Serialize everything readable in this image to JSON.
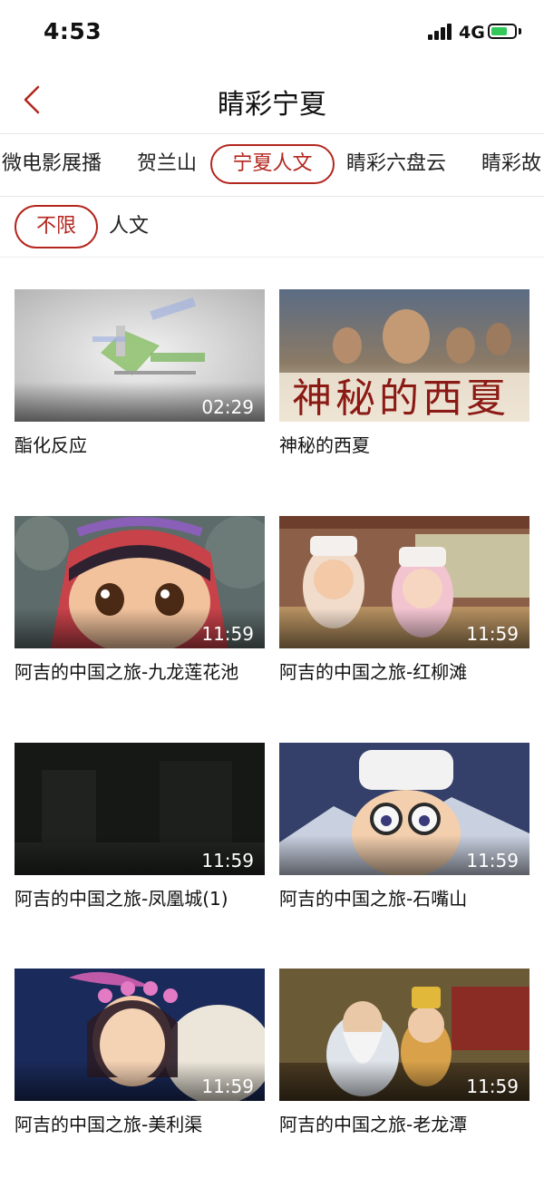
{
  "status": {
    "time": "4:53",
    "network": "4G"
  },
  "header": {
    "title": "睛彩宁夏"
  },
  "tabs": [
    {
      "label": "微电影展播",
      "active": false
    },
    {
      "label": "贺兰山",
      "active": false
    },
    {
      "label": "宁夏人文",
      "active": true
    },
    {
      "label": "睛彩六盘云",
      "active": false
    },
    {
      "label": "睛彩故",
      "active": false
    }
  ],
  "filters": [
    {
      "label": "不限",
      "active": true
    },
    {
      "label": "人文",
      "active": false
    }
  ],
  "videos": [
    {
      "title": "酯化反应",
      "duration": "02:29"
    },
    {
      "title": "神秘的西夏",
      "duration": "",
      "overlay": "神秘的西夏"
    },
    {
      "title": "阿吉的中国之旅-九龙莲花池",
      "duration": "11:59"
    },
    {
      "title": "阿吉的中国之旅-红柳滩",
      "duration": "11:59"
    },
    {
      "title": "阿吉的中国之旅-凤凰城(1)",
      "duration": "11:59"
    },
    {
      "title": "阿吉的中国之旅-石嘴山",
      "duration": "11:59"
    },
    {
      "title": "阿吉的中国之旅-美利渠",
      "duration": "11:59"
    },
    {
      "title": "阿吉的中国之旅-老龙潭",
      "duration": "11:59"
    }
  ],
  "colors": {
    "accent": "#b3261e",
    "battery": "#34c759"
  }
}
